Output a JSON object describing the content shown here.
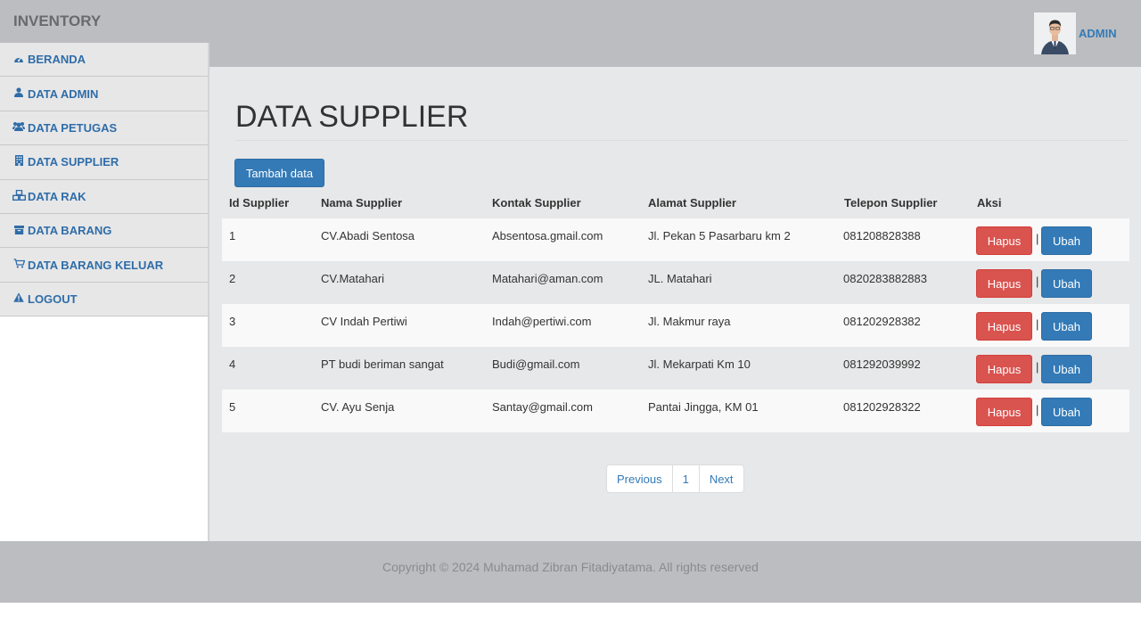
{
  "brand": "INVENTORY",
  "header": {
    "user_label": "ADMIN",
    "avatar_icon": "user-photo-icon"
  },
  "sidebar": {
    "items": [
      {
        "label": "BERANDA",
        "icon": "dashboard-icon"
      },
      {
        "label": "DATA ADMIN",
        "icon": "user-icon"
      },
      {
        "label": "DATA PETUGAS",
        "icon": "users-icon"
      },
      {
        "label": "DATA SUPPLIER",
        "icon": "building-icon"
      },
      {
        "label": "DATA RAK",
        "icon": "cubes-icon"
      },
      {
        "label": "DATA BARANG",
        "icon": "archive-icon"
      },
      {
        "label": "DATA BARANG KELUAR",
        "icon": "cart-icon"
      },
      {
        "label": "LOGOUT",
        "icon": "warning-icon"
      }
    ]
  },
  "main": {
    "title": "DATA SUPPLIER",
    "add_button": "Tambah data",
    "columns": [
      "Id Supplier",
      "Nama Supplier",
      "Kontak Supplier",
      "Alamat Supplier",
      "Telepon Supplier",
      "Aksi"
    ],
    "rows": [
      {
        "id": "1",
        "nama": "CV.Abadi Sentosa",
        "kontak": "Absentosa.gmail.com",
        "alamat": "Jl. Pekan 5 Pasarbaru km 2",
        "telepon": "081208828388"
      },
      {
        "id": "2",
        "nama": "CV.Matahari",
        "kontak": "Matahari@aman.com",
        "alamat": "JL. Matahari",
        "telepon": "0820283882883"
      },
      {
        "id": "3",
        "nama": "CV Indah Pertiwi",
        "kontak": "Indah@pertiwi.com",
        "alamat": "Jl. Makmur raya",
        "telepon": "081202928382"
      },
      {
        "id": "4",
        "nama": "PT budi beriman sangat",
        "kontak": "Budi@gmail.com",
        "alamat": "Jl. Mekarpati Km 10",
        "telepon": "081292039992"
      },
      {
        "id": "5",
        "nama": "CV. Ayu Senja",
        "kontak": "Santay@gmail.com",
        "alamat": "Pantai Jingga, KM 01",
        "telepon": "081202928322"
      }
    ],
    "delete_label": "Hapus",
    "separator": "|",
    "edit_label": "Ubah",
    "pagination": {
      "previous": "Previous",
      "current": "1",
      "next": "Next"
    }
  },
  "footer": {
    "copyright": "Copyright © 2024 Muhamad Zibran Fitadiyatama. All rights reserved"
  },
  "colors": {
    "primary": "#337ab7",
    "danger": "#d9534f",
    "topbar": "#bcbdc0",
    "content_bg": "#e7e8e9"
  }
}
